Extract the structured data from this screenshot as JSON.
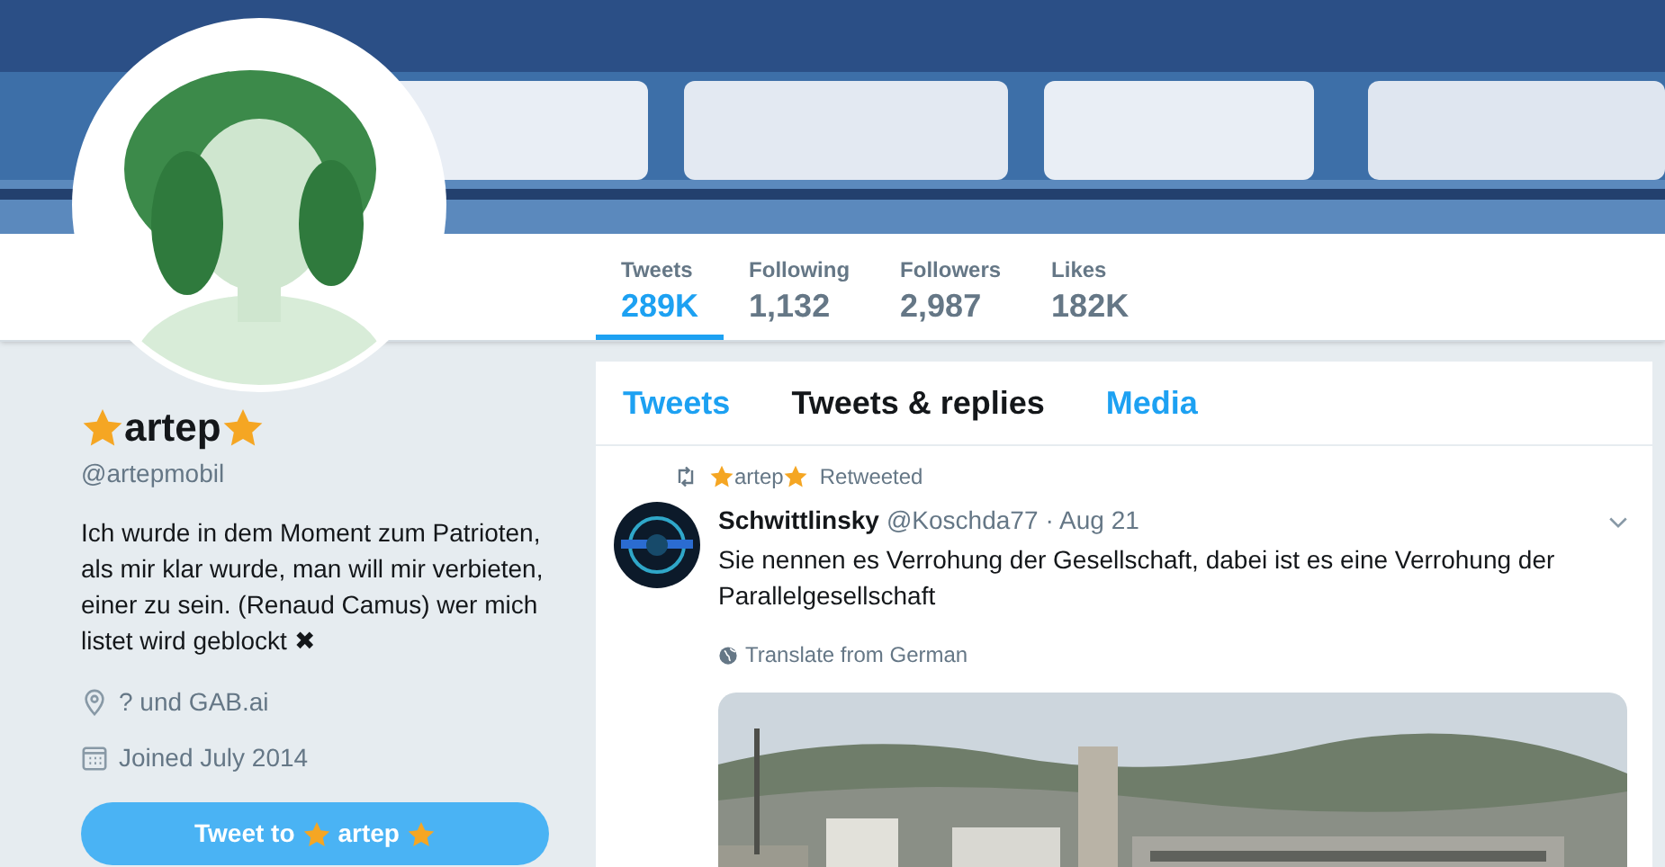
{
  "stats": [
    {
      "label": "Tweets",
      "value": "289K",
      "selected": true
    },
    {
      "label": "Following",
      "value": "1,132",
      "selected": false
    },
    {
      "label": "Followers",
      "value": "2,987",
      "selected": false
    },
    {
      "label": "Likes",
      "value": "182K",
      "selected": false
    }
  ],
  "profile": {
    "name": "artep",
    "handle": "@artepmobil",
    "bio": "Ich wurde in dem Moment zum Patrioten, als mir klar wurde, man will mir verbieten, einer zu sein. (Renaud Camus) wer mich listet wird geblockt ✖",
    "location": "? und GAB.ai",
    "joined": "Joined July 2014",
    "tweet_button": {
      "prefix": "Tweet to",
      "name": "artep"
    }
  },
  "timeline_tabs": [
    {
      "label": "Tweets",
      "selected": false
    },
    {
      "label": "Tweets & replies",
      "selected": true
    },
    {
      "label": "Media",
      "selected": false
    }
  ],
  "tweet": {
    "retweeted_by": "artep",
    "retweet_label": "Retweeted",
    "author": "Schwittlinsky",
    "handle": "@Koschda77",
    "time": "· Aug 21",
    "text": "Sie nennen es Verrohung der Gesellschaft, dabei ist es eine Verrohung der Parallelgesellschaft",
    "translate": "Translate from German"
  }
}
